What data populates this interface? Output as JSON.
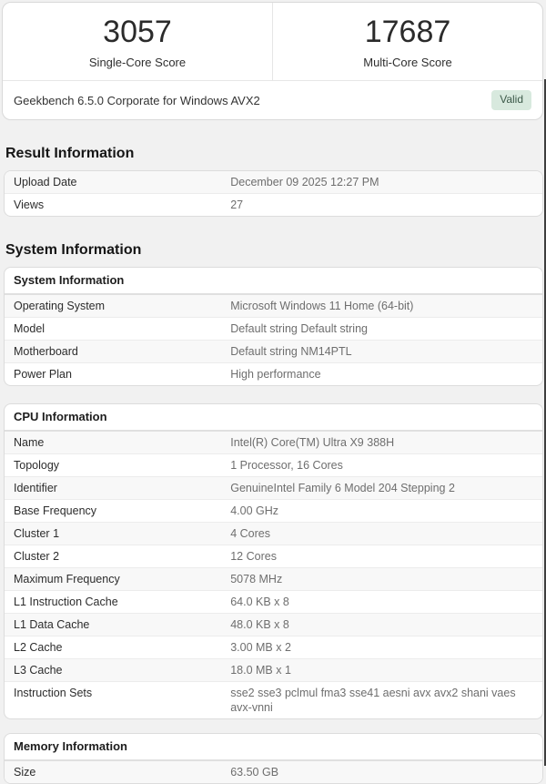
{
  "scores": {
    "single_core": {
      "value": "3057",
      "label": "Single-Core Score"
    },
    "multi_core": {
      "value": "17687",
      "label": "Multi-Core Score"
    }
  },
  "version_bar": {
    "title": "Geekbench 6.5.0 Corporate for Windows AVX2",
    "badge_label": "Valid",
    "badge_bg": "#d8e9de",
    "badge_color": "#3d5a4a"
  },
  "result_section": {
    "heading": "Result Information",
    "rows": [
      {
        "label": "Upload Date",
        "value": "December 09 2025 12:27 PM"
      },
      {
        "label": "Views",
        "value": "27"
      }
    ]
  },
  "system_section": {
    "heading": "System Information",
    "tables": [
      {
        "header": "System Information",
        "rows": [
          {
            "label": "Operating System",
            "value": "Microsoft Windows 11 Home (64-bit)"
          },
          {
            "label": "Model",
            "value": "Default string Default string"
          },
          {
            "label": "Motherboard",
            "value": "Default string NM14PTL"
          },
          {
            "label": "Power Plan",
            "value": "High performance"
          }
        ]
      },
      {
        "header": "CPU Information",
        "rows": [
          {
            "label": "Name",
            "value": "Intel(R) Core(TM) Ultra X9 388H"
          },
          {
            "label": "Topology",
            "value": "1 Processor, 16 Cores"
          },
          {
            "label": "Identifier",
            "value": "GenuineIntel Family 6 Model 204 Stepping 2"
          },
          {
            "label": "Base Frequency",
            "value": "4.00 GHz"
          },
          {
            "label": "Cluster 1",
            "value": "4 Cores"
          },
          {
            "label": "Cluster 2",
            "value": "12 Cores"
          },
          {
            "label": "Maximum Frequency",
            "value": "5078 MHz"
          },
          {
            "label": "L1 Instruction Cache",
            "value": "64.0 KB x 8"
          },
          {
            "label": "L1 Data Cache",
            "value": "48.0 KB x 8"
          },
          {
            "label": "L2 Cache",
            "value": "3.00 MB x 2"
          },
          {
            "label": "L3 Cache",
            "value": "18.0 MB x 1"
          },
          {
            "label": "Instruction Sets",
            "value": "sse2 sse3 pclmul fma3 sse41 aesni avx avx2 shani vaes avx-vnni"
          }
        ]
      },
      {
        "header": "Memory Information",
        "rows": [
          {
            "label": "Size",
            "value": "63.50 GB"
          }
        ]
      }
    ]
  }
}
